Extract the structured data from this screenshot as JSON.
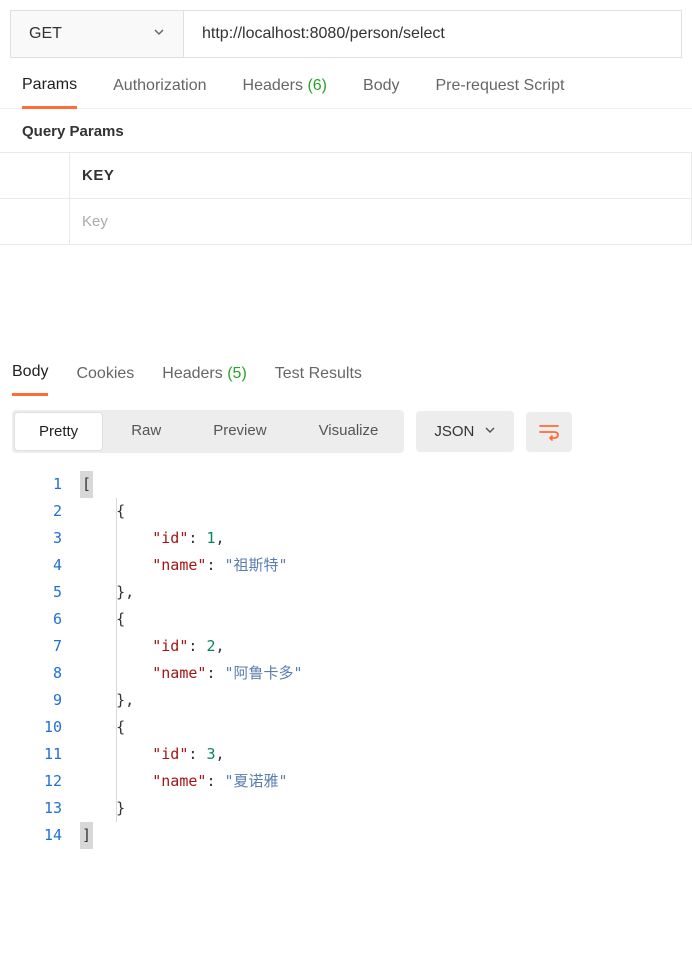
{
  "request": {
    "method": "GET",
    "url": "http://localhost:8080/person/select"
  },
  "requestTabs": {
    "params": "Params",
    "authorization": "Authorization",
    "headersLabel": "Headers",
    "headersCount": "(6)",
    "body": "Body",
    "preRequest": "Pre-request Script"
  },
  "queryParams": {
    "subheader": "Query Params",
    "keyHeader": "KEY",
    "keyPlaceholder": "Key"
  },
  "responseTabs": {
    "body": "Body",
    "cookies": "Cookies",
    "headersLabel": "Headers",
    "headersCount": "(5)",
    "testResults": "Test Results"
  },
  "viewModes": {
    "pretty": "Pretty",
    "raw": "Raw",
    "preview": "Preview",
    "visualize": "Visualize"
  },
  "formatSelect": "JSON",
  "code": {
    "lines": [
      "1",
      "2",
      "3",
      "4",
      "5",
      "6",
      "7",
      "8",
      "9",
      "10",
      "11",
      "12",
      "13",
      "14"
    ],
    "l1": "[",
    "l2": "{",
    "k_id": "\"id\"",
    "k_name": "\"name\"",
    "colon": ": ",
    "comma": ",",
    "v_id1": "1",
    "v_name1": "\"祖斯特\"",
    "v_id2": "2",
    "v_name2": "\"阿鲁卡多\"",
    "v_id3": "3",
    "v_name3": "\"夏诺雅\"",
    "rbrace": "}",
    "rbrace_comma": "},",
    "rbracket": "]"
  }
}
